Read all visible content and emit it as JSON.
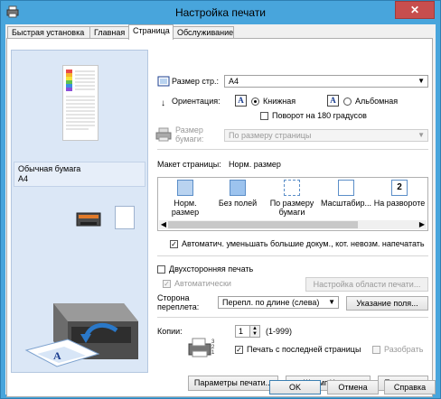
{
  "window": {
    "title": "Настройка печати",
    "close_glyph": "✕"
  },
  "tabs": [
    {
      "label": "Быстрая установка"
    },
    {
      "label": "Главная"
    },
    {
      "label": "Страница"
    },
    {
      "label": "Обслуживание"
    }
  ],
  "preview": {
    "paper_type": "Обычная бумага",
    "paper_size": "A4"
  },
  "page_size": {
    "label": "Размер стр.:",
    "value": "A4"
  },
  "orientation": {
    "label": "Ориентация:",
    "portrait": "Книжная",
    "landscape": "Альбомная",
    "rotate180": "Поворот на 180 градусов",
    "icon_letter": "A",
    "arrow_glyph": "↓"
  },
  "paper_size": {
    "label_line1": "Размер",
    "label_line2": "бумаги:",
    "value": "По размеру страницы"
  },
  "layout": {
    "label": "Макет страницы:",
    "current": "Норм. размер",
    "items": [
      {
        "line1": "Норм.",
        "line2": "размер"
      },
      {
        "line1": "Без полей",
        "line2": ""
      },
      {
        "line1": "По размеру",
        "line2": "бумаги"
      },
      {
        "line1": "Масштабир...",
        "line2": ""
      },
      {
        "line1": "На развороте",
        "line2": "",
        "badge": "2"
      }
    ],
    "scroll_left": "◀",
    "scroll_right": "▶"
  },
  "auto_reduce": {
    "label": "Автоматич. уменьшать большие докум., кот. невозм. напечатать",
    "checked": true
  },
  "duplex": {
    "label": "Двухсторонняя печать",
    "checked": false,
    "auto_label": "Автоматически",
    "auto_checked": true,
    "area_button": "Настройка области печати..."
  },
  "binding": {
    "label_line1": "Сторона",
    "label_line2": "переплета:",
    "value": "Перепл. по длине (слева)",
    "margin_button": "Указание поля..."
  },
  "copies": {
    "label": "Копии:",
    "value": "1",
    "range": "(1-999)",
    "last_page_first": "Печать с последней страницы",
    "last_page_checked": true,
    "collate": "Разобрать",
    "collate_checked": false,
    "spin_up": "▲",
    "spin_down": "▼"
  },
  "bottom_buttons": {
    "print_options": "Параметры печати...",
    "stamp": "Штамп/Фон...",
    "defaults": "По умолч."
  },
  "dialog_buttons": {
    "ok": "OK",
    "cancel": "Отмена",
    "help": "Справка"
  },
  "colors": {
    "titlebar": "#48a5dc",
    "close": "#c74e4e",
    "preview_bg": "#dbe7f6"
  }
}
